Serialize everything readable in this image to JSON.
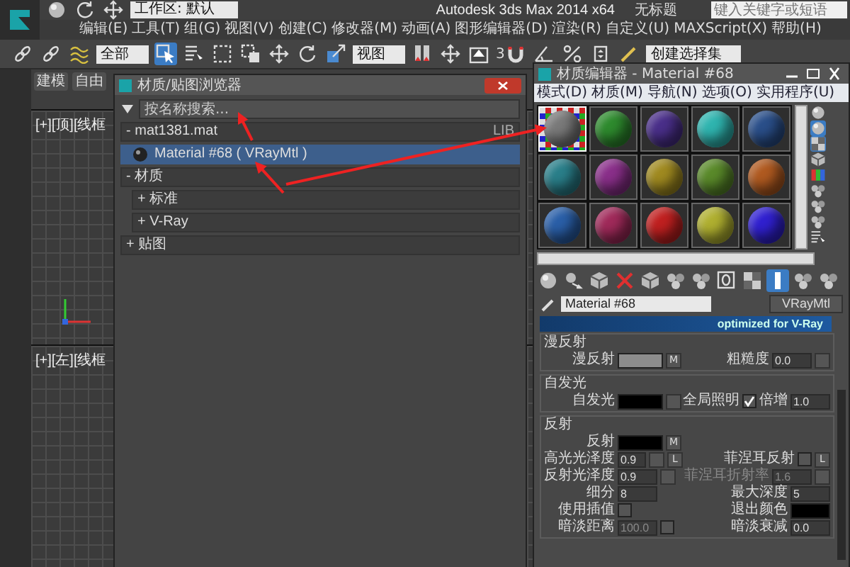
{
  "titlebar": {
    "workspace": "工作区: 默认",
    "title": "Autodesk 3ds Max  2014 x64",
    "document": "无标题",
    "search": {
      "placeholder": "键入关键字或短语"
    }
  },
  "menu": [
    "编辑(E)",
    "工具(T)",
    "组(G)",
    "视图(V)",
    "创建(C)",
    "修改器(M)",
    "动画(A)",
    "图形编辑器(D)",
    "渲染(R)",
    "自定义(U)",
    "MAXScript(X)",
    "帮助(H)"
  ],
  "toolbar": [
    {
      "kind": "link",
      "selected": false
    },
    {
      "kind": "unlink",
      "selected": false
    },
    {
      "kind": "bind",
      "selected": false
    },
    {
      "kind": "dropdown",
      "value": "全部"
    },
    {
      "kind": "select",
      "selected": true
    },
    {
      "kind": "select-name",
      "selected": false
    },
    {
      "kind": "region",
      "selected": false
    },
    {
      "kind": "window",
      "selected": false
    },
    {
      "kind": "move",
      "selected": false
    },
    {
      "kind": "rotate",
      "selected": false
    },
    {
      "kind": "scale",
      "selected": false
    },
    {
      "kind": "dropdown",
      "value": "视图"
    },
    {
      "kind": "mirror",
      "selected": false
    },
    {
      "kind": "pivot",
      "selected": false
    },
    {
      "kind": "place",
      "selected": false
    },
    {
      "kind": "snap",
      "value": "3",
      "selected": false
    },
    {
      "kind": "angle",
      "selected": false
    },
    {
      "kind": "percent",
      "selected": false
    },
    {
      "kind": "spinner",
      "selected": false
    },
    {
      "kind": "edit",
      "selected": false
    },
    {
      "kind": "dropdown",
      "value": "创建选择集"
    }
  ],
  "command_tabs": [
    {
      "label": "建模"
    },
    {
      "label": "自由"
    }
  ],
  "viewports": [
    {
      "label": "[+][顶][线框"
    },
    {
      "label": "[+][左][线框"
    }
  ],
  "browser": {
    "title": "材质/贴图浏览器",
    "search": {
      "placeholder": "按名称搜索..."
    },
    "groups": [
      {
        "label": "- mat1381.mat",
        "badge": "LIB",
        "children": [
          {
            "kind": "material",
            "label": "Material #68 ( VRayMtl )",
            "selected": true
          }
        ]
      },
      {
        "label": "- 材质",
        "children": [
          {
            "kind": "category",
            "label": "+ 标准",
            "selected": false
          },
          {
            "kind": "category",
            "label": "+ V-Ray",
            "selected": false
          }
        ]
      },
      {
        "label": "+ 贴图"
      }
    ]
  },
  "editor": {
    "title": "材质编辑器 - Material #68",
    "menu": [
      "模式(D)",
      "材质(M)",
      "导航(N)",
      "选项(O)",
      "实用程序(U)"
    ],
    "spheres": [
      {
        "color": "#7a7a7a",
        "selected": true
      },
      {
        "color": "#2e8b2e",
        "selected": false
      },
      {
        "color": "#4a2f8a",
        "selected": false
      },
      {
        "color": "#2fb5b0",
        "selected": false
      },
      {
        "color": "#2a4f8a",
        "selected": false
      },
      {
        "color": "#2a7f8a",
        "selected": false
      },
      {
        "color": "#8a2f8a",
        "selected": false
      },
      {
        "color": "#a08a20",
        "selected": false
      },
      {
        "color": "#5a8a2a",
        "selected": false
      },
      {
        "color": "#b05a20",
        "selected": false
      },
      {
        "color": "#2a5fa8",
        "selected": false
      },
      {
        "color": "#a02a5a",
        "selected": false
      },
      {
        "color": "#c02020",
        "selected": false
      },
      {
        "color": "#b0b030",
        "selected": false
      },
      {
        "color": "#3020d0",
        "selected": false
      }
    ],
    "side_tools": [
      {
        "kind": "sphere",
        "selected": false
      },
      {
        "kind": "backlight",
        "selected": true
      },
      {
        "kind": "checker",
        "selected": true
      },
      {
        "kind": "cube",
        "selected": false
      },
      {
        "kind": "bars",
        "selected": false
      },
      {
        "kind": "options",
        "selected": false
      },
      {
        "kind": "select-by",
        "selected": false
      },
      {
        "kind": "navigator",
        "selected": false
      },
      {
        "kind": "tree",
        "selected": false
      }
    ],
    "bottom_tools": [
      {
        "kind": "get",
        "selected": false
      },
      {
        "kind": "put",
        "selected": false
      },
      {
        "kind": "assign",
        "selected": false
      },
      {
        "kind": "delete",
        "selected": false
      },
      {
        "kind": "copy",
        "selected": false
      },
      {
        "kind": "unique",
        "selected": false
      },
      {
        "kind": "library",
        "selected": false
      },
      {
        "kind": "effect-id",
        "selected": false
      },
      {
        "kind": "show-map",
        "selected": false
      },
      {
        "kind": "show-shaded",
        "selected": true
      },
      {
        "kind": "result",
        "selected": false
      },
      {
        "kind": "parent",
        "selected": false
      }
    ],
    "material_name": "Material #68",
    "material_type": "VRayMtl",
    "banner": "optimized for V-Ray",
    "sections": [
      {
        "title": "漫反射",
        "rows": [
          {
            "left": [
              {
                "kind": "label",
                "text": "漫反射",
                "disabled": false
              },
              {
                "kind": "swatch",
                "color": "#8c8c8c"
              },
              {
                "kind": "map",
                "text": "M"
              }
            ],
            "right": [
              {
                "kind": "label",
                "text": "粗糙度",
                "disabled": false
              },
              {
                "kind": "spinner",
                "value": "0.0",
                "disabled": false
              },
              {
                "kind": "map"
              }
            ]
          }
        ]
      },
      {
        "title": "自发光",
        "rows": [
          {
            "left": [
              {
                "kind": "label",
                "text": "自发光",
                "disabled": false
              },
              {
                "kind": "swatch",
                "color": "#000000"
              },
              {
                "kind": "map"
              }
            ],
            "right": [
              {
                "kind": "label",
                "text": "全局照明",
                "disabled": false
              },
              {
                "kind": "check",
                "checked": true
              },
              {
                "kind": "label",
                "text": "倍增",
                "disabled": false
              },
              {
                "kind": "spinner",
                "value": "1.0",
                "disabled": false
              }
            ]
          }
        ]
      },
      {
        "title": "反射",
        "rows": [
          {
            "left": [
              {
                "kind": "label",
                "text": "反射",
                "disabled": false
              },
              {
                "kind": "swatch",
                "color": "#000000"
              },
              {
                "kind": "map",
                "text": "M"
              }
            ],
            "right": []
          },
          {
            "left": [
              {
                "kind": "label",
                "text": "高光光泽度",
                "disabled": false
              },
              {
                "kind": "spinner",
                "value": "0.9",
                "disabled": false
              },
              {
                "kind": "map"
              },
              {
                "kind": "map",
                "text": "L"
              }
            ],
            "right": [
              {
                "kind": "label",
                "text": "菲涅耳反射",
                "disabled": false
              },
              {
                "kind": "check",
                "checked": false
              },
              {
                "kind": "map",
                "text": "L"
              }
            ]
          },
          {
            "left": [
              {
                "kind": "label",
                "text": "反射光泽度",
                "disabled": false
              },
              {
                "kind": "spinner",
                "value": "0.9",
                "disabled": false
              },
              {
                "kind": "map"
              }
            ],
            "right": [
              {
                "kind": "label",
                "text": "菲涅耳折射率",
                "disabled": true
              },
              {
                "kind": "spinner",
                "value": "1.6",
                "disabled": true
              },
              {
                "kind": "map"
              }
            ]
          },
          {
            "left": [
              {
                "kind": "label",
                "text": "细分",
                "disabled": false
              },
              {
                "kind": "spinner",
                "value": "8",
                "disabled": false
              }
            ],
            "right": [
              {
                "kind": "label",
                "text": "最大深度",
                "disabled": false
              },
              {
                "kind": "spinner",
                "value": "5",
                "disabled": false
              }
            ]
          },
          {
            "left": [
              {
                "kind": "label",
                "text": "使用插值",
                "disabled": false
              },
              {
                "kind": "check",
                "checked": false
              }
            ],
            "right": [
              {
                "kind": "label",
                "text": "退出颜色",
                "disabled": false
              },
              {
                "kind": "swatch",
                "color": "#000000"
              }
            ]
          },
          {
            "left": [
              {
                "kind": "label",
                "text": "暗淡距离",
                "disabled": false
              },
              {
                "kind": "spinner",
                "value": "100.0",
                "disabled": true
              },
              {
                "kind": "check",
                "checked": false
              }
            ],
            "right": [
              {
                "kind": "label",
                "text": "暗淡衰减",
                "disabled": false
              },
              {
                "kind": "spinner",
                "value": "0.0",
                "disabled": false
              }
            ]
          }
        ]
      }
    ]
  }
}
